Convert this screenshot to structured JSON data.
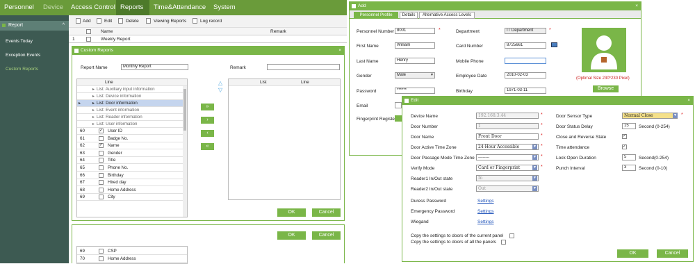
{
  "topnav": {
    "items": [
      "Personnel",
      "Device",
      "Access Control",
      "Reports",
      "Time&Attendance",
      "System"
    ]
  },
  "sidebar": {
    "header": "Report",
    "items": [
      "Events Today",
      "Exception Events",
      "Custom Reports"
    ]
  },
  "toolbar": {
    "add": "Add",
    "edit": "Edit",
    "delete": "Delete",
    "view": "Viewing Reports",
    "log": "Log record"
  },
  "list": {
    "col_name": "Name",
    "col_remark": "Remark",
    "row_num": "1",
    "row_name": "Weekly Report"
  },
  "custom": {
    "title": "Custom Reports",
    "report_name_label": "Report Name",
    "report_name_value": "Monthly Report",
    "remark_label": "Remark",
    "line_header": "Line",
    "list_header": "List",
    "line_header2": "Line",
    "groups": [
      "List: Auxiliary input information",
      "List: Device information",
      "List: Door information",
      "List: Event information",
      "List: Reader information",
      "List: User information"
    ],
    "fields": [
      [
        "60",
        "User ID"
      ],
      [
        "61",
        "Badge No."
      ],
      [
        "62",
        "Name"
      ],
      [
        "63",
        "Gender"
      ],
      [
        "64",
        "Title"
      ],
      [
        "65",
        "Phone No."
      ],
      [
        "66",
        "Birthday"
      ],
      [
        "67",
        "Hired day"
      ],
      [
        "68",
        "Home Address"
      ],
      [
        "69",
        "City"
      ]
    ],
    "checked": [
      true,
      false,
      true,
      false,
      false,
      false,
      false,
      false,
      false,
      false
    ],
    "ok": "OK",
    "cancel": "Cancel",
    "bottom_rows": [
      [
        "69",
        "CSP"
      ],
      [
        "70",
        "Home Address"
      ]
    ],
    "bottom_ok": "OK",
    "bottom_cancel": "Cancel",
    "move_right": "»",
    "move_one_right": "›",
    "move_one_left": "‹",
    "move_left": "«",
    "arrow_up": "△",
    "arrow_down": "▽"
  },
  "add": {
    "title": "Add",
    "tabs": [
      "Personnel Profile",
      "Details",
      "Alternative Access Levels"
    ],
    "fields": {
      "personnel_number": [
        "Personnel Number",
        "8001"
      ],
      "first_name": [
        "First Name",
        "William"
      ],
      "last_name": [
        "Last Name",
        "Henry"
      ],
      "gender": [
        "Gender",
        "Male"
      ],
      "password": [
        "Password",
        "******"
      ],
      "email": [
        "Email",
        ""
      ],
      "fingerprint": [
        "Fingerprint Registe",
        ""
      ],
      "department": [
        "Department",
        "IT Department"
      ],
      "card_number": [
        "Card Number",
        "8725661"
      ],
      "mobile": [
        "Mobile Phone",
        ""
      ],
      "employee_date": [
        "Employee Date",
        "2010-02-03"
      ],
      "birthday": [
        "Birthday",
        "1971-03-11"
      ]
    },
    "photo_hint": "(Optimal Size 230*230 Pixel)",
    "browse": "Browse"
  },
  "edit": {
    "title": "Edit",
    "left": [
      [
        "Device Name",
        "192.168.3.44"
      ],
      [
        "Door Number",
        "1"
      ],
      [
        "Door Name",
        "Front Door"
      ],
      [
        "Door Active Time Zone",
        "24-Hour Accessible"
      ],
      [
        "Door Passage Mode Time Zone",
        "--------"
      ],
      [
        "Verify Mode",
        "Card or Fingerprint"
      ],
      [
        "Reader1 In/Out state",
        "In"
      ],
      [
        "Reader2 In/Out state",
        "Out"
      ]
    ],
    "links": [
      [
        "Duress Password",
        "Settings"
      ],
      [
        "Emergency Password",
        "Settings"
      ],
      [
        "Wiegand",
        "Settings"
      ]
    ],
    "right": [
      [
        "Door Sensor Type",
        "Normal Close"
      ],
      [
        "Door Status Delay",
        "15",
        "Second (0-254)"
      ],
      [
        "Close and Reverse State",
        ""
      ],
      [
        "Time attendance",
        ""
      ],
      [
        "Lock Open Duration",
        "5",
        "Second(0-254)"
      ],
      [
        "Punch Interval",
        "3",
        "Second (0-10)"
      ]
    ],
    "copy1": "Copy the settings to doors of the current panel",
    "copy2": "Copy the settings to doors of all the panels",
    "ok": "OK",
    "cancel": "Cancel"
  },
  "colors": {
    "green": "#7ab648",
    "nav": "#6a9b3a",
    "sidebar": "#3d5a52",
    "sidebar_header": "#5e7f76",
    "selected_row": "#c5d5ee",
    "required": "#d22222",
    "link": "#2255bb"
  }
}
